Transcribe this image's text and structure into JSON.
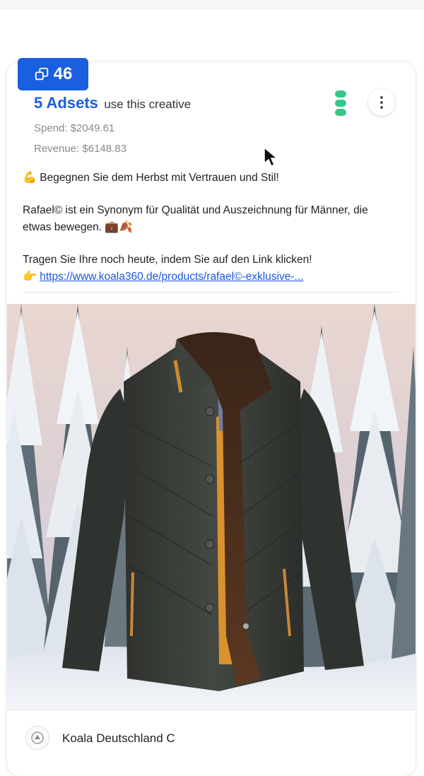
{
  "badge": {
    "count": "46"
  },
  "adsets": {
    "link": "5 Adsets",
    "suffix": "use this creative"
  },
  "metrics": {
    "spend": "Spend: $2049.61",
    "revenue": "Revenue: $6148.83"
  },
  "ad_text": {
    "headline_emoji": "💪",
    "headline": "Begegnen Sie dem Herbst mit Vertrauen und Stil!",
    "paragraph": "Rafael© ist ein Synonym für Qualität und Auszeichnung für Männer, die etwas bewegen.",
    "paragraph_emoji": "💼🍂",
    "cta": "Tragen Sie Ihre noch heute, indem Sie auf den Link klicken!",
    "cta_emoji": "👉",
    "url": "https://www.koala360.de/products/rafael©-exklusive-..."
  },
  "page": {
    "name": "Koala Deutschland C"
  },
  "colors": {
    "accent": "#1a5fe0",
    "status": "#34c785",
    "jacket": "#3d403b",
    "lining": "#d9922e"
  },
  "icons": {
    "badge": "copy-icon",
    "menu": "more-vertical-icon",
    "status": "status-indicator-icon",
    "cta": "pointing-hand-icon",
    "logo": "koala-logo-icon"
  }
}
